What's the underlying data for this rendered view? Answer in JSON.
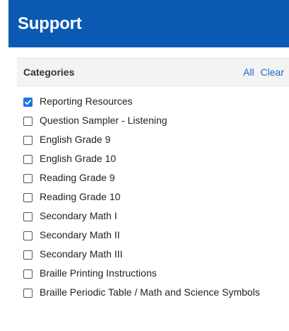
{
  "header": {
    "title": "Support",
    "background_color": "#0a5ab4"
  },
  "categories_panel": {
    "title": "Categories",
    "all_link": "All",
    "clear_link": "Clear",
    "link_color": "#1b6ac9",
    "checked_color": "#1a73e8",
    "items": [
      {
        "label": "Reporting Resources",
        "checked": true
      },
      {
        "label": "Question Sampler - Listening",
        "checked": false
      },
      {
        "label": "English Grade 9",
        "checked": false
      },
      {
        "label": "English Grade 10",
        "checked": false
      },
      {
        "label": "Reading Grade 9",
        "checked": false
      },
      {
        "label": "Reading Grade 10",
        "checked": false
      },
      {
        "label": "Secondary Math I",
        "checked": false
      },
      {
        "label": "Secondary Math II",
        "checked": false
      },
      {
        "label": "Secondary Math III",
        "checked": false
      },
      {
        "label": "Braille Printing Instructions",
        "checked": false
      },
      {
        "label": "Braille Periodic Table / Math and Science Symbols",
        "checked": false
      }
    ]
  }
}
